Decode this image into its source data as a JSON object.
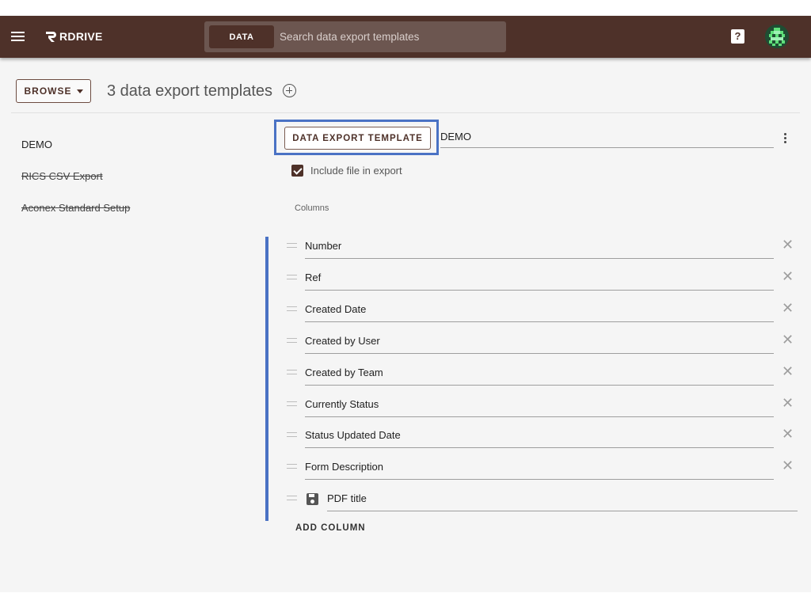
{
  "app": {
    "name": "RDRIVE",
    "accent": "#4e3129",
    "highlight": "#4a72c4"
  },
  "search": {
    "chip_label": "DATA",
    "placeholder": "Search data export templates"
  },
  "toolbar": {
    "browse_label": "BROWSE",
    "heading": "3 data export templates"
  },
  "templates": [
    {
      "label": "DEMO",
      "strikethrough": false
    },
    {
      "label": "RICS CSV Export",
      "strikethrough": true
    },
    {
      "label": "Aconex Standard Setup",
      "strikethrough": true
    }
  ],
  "editor": {
    "type_button": "DATA EXPORT TEMPLATE",
    "name_value": "DEMO",
    "include_label": "Include file in export",
    "include_checked": true,
    "columns_label": "Columns",
    "columns": [
      "Number",
      "Ref",
      "Created Date",
      "Created by User",
      "Created by Team",
      "Currently Status",
      "Status Updated Date",
      "Form Description"
    ],
    "pdf_column": "PDF title",
    "add_column_label": "ADD COLUMN"
  },
  "icons": {
    "menu": "menu-icon",
    "help": "help-icon",
    "close": "close-icon",
    "drag": "drag-handle-icon",
    "save": "save-icon"
  }
}
